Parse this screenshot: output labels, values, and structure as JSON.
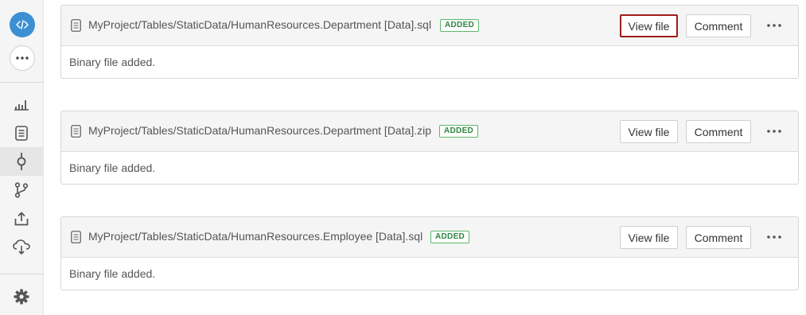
{
  "sidebar": {
    "logo_icon": "code-icon",
    "more_icon": "ellipsis-icon",
    "items": [
      {
        "name": "stats",
        "icon": "bar-chart-icon"
      },
      {
        "name": "files",
        "icon": "document-icon"
      },
      {
        "name": "commits",
        "icon": "commit-icon",
        "active": true
      },
      {
        "name": "branches",
        "icon": "branch-icon"
      },
      {
        "name": "upload",
        "icon": "upload-icon"
      },
      {
        "name": "cloud",
        "icon": "cloud-download-icon"
      }
    ],
    "settings_icon": "gear-icon"
  },
  "files": [
    {
      "path": "MyProject/Tables/StaticData/HumanResources.Department [Data].sql",
      "status": "ADDED",
      "view_label": "View file",
      "comment_label": "Comment",
      "body": "Binary file added."
    },
    {
      "path": "MyProject/Tables/StaticData/HumanResources.Department [Data].zip",
      "status": "ADDED",
      "view_label": "View file",
      "comment_label": "Comment",
      "body": "Binary file added."
    },
    {
      "path": "MyProject/Tables/StaticData/HumanResources.Employee [Data].sql",
      "status": "ADDED",
      "view_label": "View file",
      "comment_label": "Comment",
      "body": "Binary file added."
    }
  ],
  "colors": {
    "accent": "#3d8fd4",
    "added": "#2e8540",
    "highlight": "#a01c1c"
  }
}
